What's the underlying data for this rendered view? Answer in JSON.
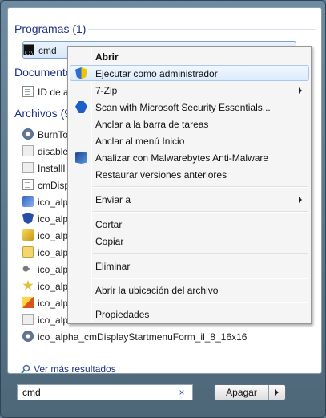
{
  "sections": {
    "programs": "Programas (1)",
    "documents": "Documentos",
    "files": "Archivos (9)"
  },
  "programs_items": [
    {
      "label": "cmd",
      "icon": "cmd-icon"
    }
  ],
  "documents_items": [
    {
      "label": "ID de a...",
      "icon": "document-icon"
    }
  ],
  "files_items": [
    {
      "label": "BurnToDisc",
      "icon": "gear-icon"
    },
    {
      "label": "disable",
      "icon": "gray-file-icon"
    },
    {
      "label": "InstallH",
      "icon": "gray-file-icon"
    },
    {
      "label": "cmDisplay",
      "icon": "document-icon"
    },
    {
      "label": "ico_alpha",
      "icon": "image-icon"
    },
    {
      "label": "ico_alpha",
      "icon": "shield-icon"
    },
    {
      "label": "ico_alpha",
      "icon": "yellow-icon"
    },
    {
      "label": "ico_alpha",
      "icon": "folder-icon"
    },
    {
      "label": "ico_alpha",
      "icon": "key-icon"
    },
    {
      "label": "ico_alpha",
      "icon": "star-icon"
    },
    {
      "label": "ico_alpha",
      "icon": "pencil-icon"
    },
    {
      "label": "ico_alpha",
      "icon": "gray-file-icon"
    },
    {
      "label": "ico_alpha_cmDisplayStartmenuForm_il_8_16x16",
      "icon": "gear-icon"
    }
  ],
  "see_more": "Ver más resultados",
  "search": {
    "value": "cmd",
    "clear_symbol": "×"
  },
  "shutdown_label": "Apagar",
  "context_menu": [
    {
      "label": "Abrir",
      "bold": true
    },
    {
      "label": "Ejecutar como administrador",
      "icon": "uac-shield-icon",
      "hot": true
    },
    {
      "label": "7-Zip",
      "submenu": true
    },
    {
      "label": "Scan with Microsoft Security Essentials...",
      "icon": "security-essentials-icon"
    },
    {
      "label": "Anclar a la barra de tareas"
    },
    {
      "label": "Anclar al menú Inicio"
    },
    {
      "label": "Analizar con Malwarebytes Anti-Malware",
      "icon": "malwarebytes-icon"
    },
    {
      "label": "Restaurar versiones anteriores"
    },
    {
      "label": "Enviar a",
      "submenu": true
    },
    {
      "label": "Cortar"
    },
    {
      "label": "Copiar"
    },
    {
      "label": "Eliminar"
    },
    {
      "label": "Abrir la ubicación del archivo"
    },
    {
      "label": "Propiedades"
    }
  ],
  "colors": {
    "header_text": "#1e3287",
    "selection_border": "#7da2ce",
    "hover_fill": "#dcebfc"
  }
}
